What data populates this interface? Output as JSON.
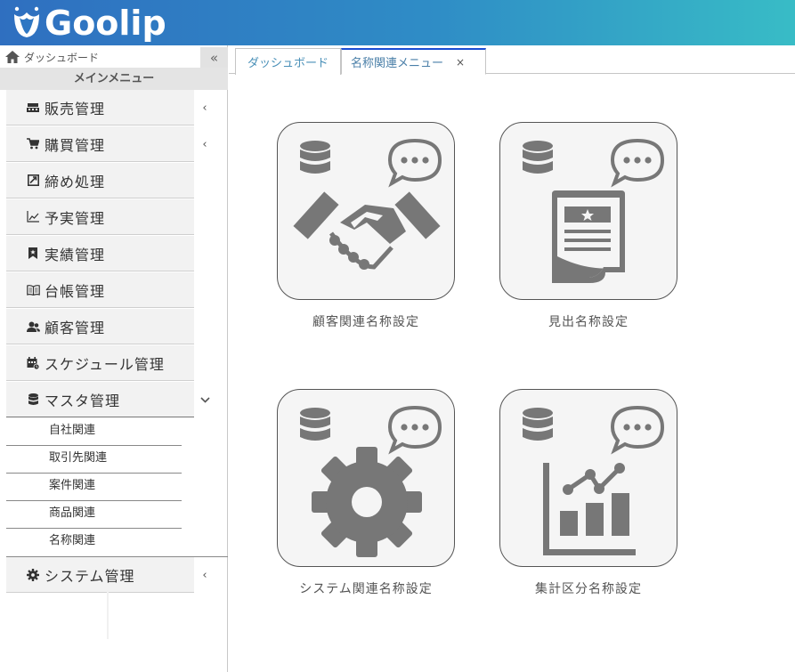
{
  "app": {
    "logo_text": "Goolip"
  },
  "sidebar": {
    "home_label": "ダッシュボード",
    "collapse_glyph": "«",
    "menu_heading": "メインメニュー",
    "items": [
      {
        "label": "販売管理",
        "icon": "register-icon",
        "chevron": "‹"
      },
      {
        "label": "購買管理",
        "icon": "cart-icon",
        "chevron": "‹"
      },
      {
        "label": "締め処理",
        "icon": "checkbox-icon",
        "chevron": ""
      },
      {
        "label": "予実管理",
        "icon": "line-chart-icon",
        "chevron": ""
      },
      {
        "label": "実績管理",
        "icon": "bookmark-icon",
        "chevron": ""
      },
      {
        "label": "台帳管理",
        "icon": "book-icon",
        "chevron": ""
      },
      {
        "label": "顧客管理",
        "icon": "users-icon",
        "chevron": ""
      },
      {
        "label": "スケジュール管理",
        "icon": "calendar-icon",
        "chevron": ""
      },
      {
        "label": "マスタ管理",
        "icon": "database-icon",
        "chevron": "⌄"
      },
      {
        "label": "システム管理",
        "icon": "gear-icon",
        "chevron": "‹"
      }
    ],
    "master_sub": [
      "自社関連",
      "取引先関連",
      "案件関連",
      "商品関連",
      "名称関連"
    ]
  },
  "tabs": [
    {
      "label": "ダッシュボード"
    },
    {
      "label": "名称関連メニュー",
      "close": "×"
    }
  ],
  "cards": [
    {
      "caption": "顧客関連名称設定",
      "icon": "handshake-icon"
    },
    {
      "caption": "見出名称設定",
      "icon": "document-icon"
    },
    {
      "caption": "システム関連名称設定",
      "icon": "gear-icon"
    },
    {
      "caption": "集計区分名称設定",
      "icon": "bar-chart-icon"
    }
  ],
  "colors": {
    "icon_gray": "#777777",
    "tab_active_border": "#1c4cd1",
    "header_start": "#2f6fc0",
    "header_end": "#38bcc6"
  }
}
